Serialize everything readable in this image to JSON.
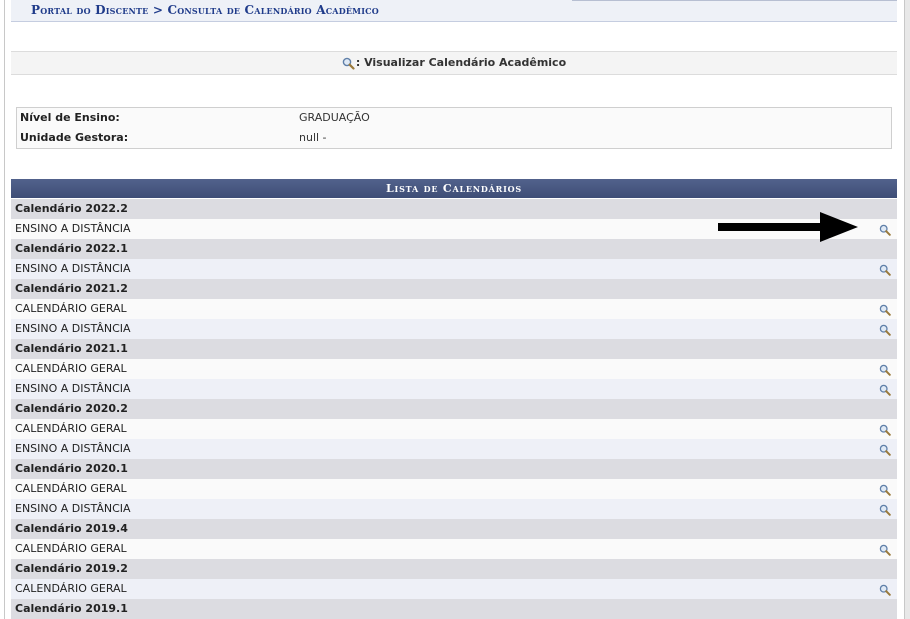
{
  "breadcrumb": {
    "text": "Portal do Discente > Consulta de Calendário Acadêmico"
  },
  "view_title": ": Visualizar Calendário Acadêmico",
  "info": {
    "nivel_label": "Nível de Ensino:",
    "nivel_value": "GRADUAÇÃO",
    "unidade_label": "Unidade Gestora:",
    "unidade_value": "null -"
  },
  "list": {
    "caption": "Lista de Calendários",
    "groups": [
      {
        "title": "Calendário 2022.2",
        "items": [
          "ENSINO A DISTÂNCIA"
        ]
      },
      {
        "title": "Calendário 2022.1",
        "items": [
          "ENSINO A DISTÂNCIA"
        ]
      },
      {
        "title": "Calendário 2021.2",
        "items": [
          "CALENDÁRIO GERAL",
          "ENSINO A DISTÂNCIA"
        ]
      },
      {
        "title": "Calendário 2021.1",
        "items": [
          "CALENDÁRIO GERAL",
          "ENSINO A DISTÂNCIA"
        ]
      },
      {
        "title": "Calendário 2020.2",
        "items": [
          "CALENDÁRIO GERAL",
          "ENSINO A DISTÂNCIA"
        ]
      },
      {
        "title": "Calendário 2020.1",
        "items": [
          "CALENDÁRIO GERAL",
          "ENSINO A DISTÂNCIA"
        ]
      },
      {
        "title": "Calendário 2019.4",
        "items": [
          "CALENDÁRIO GERAL"
        ]
      },
      {
        "title": "Calendário 2019.2",
        "items": [
          "CALENDÁRIO GERAL"
        ]
      },
      {
        "title": "Calendário 2019.1",
        "items": []
      }
    ]
  },
  "icons": {
    "view": "magnifier-icon",
    "annotation": "arrow-right-icon"
  },
  "colors": {
    "breadcrumb_text": "#1f3b8a",
    "caption_bg": "#46557f",
    "group_row_bg": "#dcdce1"
  }
}
